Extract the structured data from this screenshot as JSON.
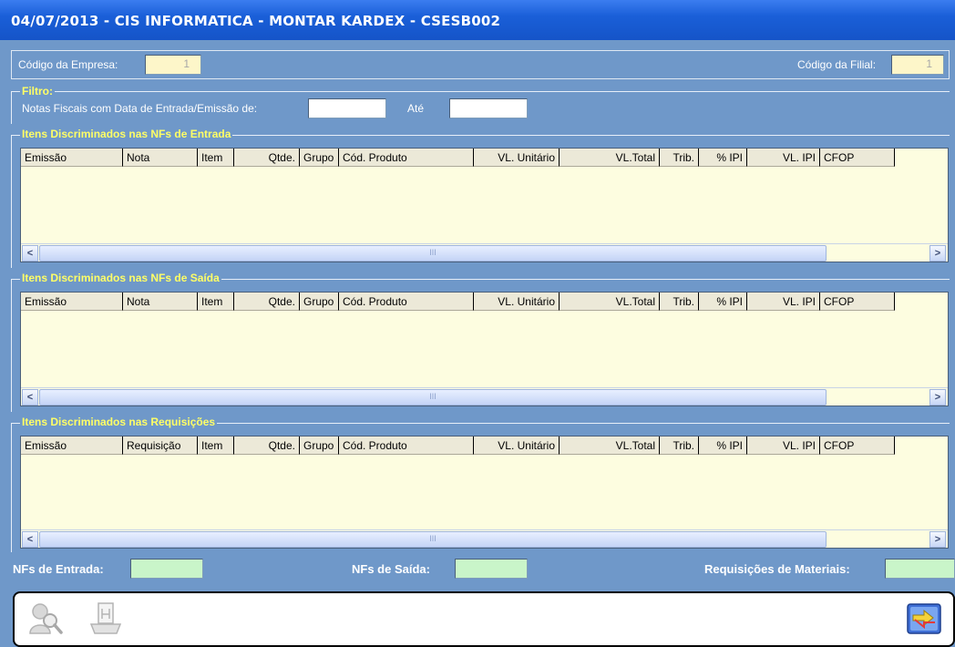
{
  "window": {
    "title": "04/07/2013  -  CIS INFORMATICA  -  MONTAR KARDEX  -  CSESB002"
  },
  "header": {
    "empresa_label": "Código da Empresa:",
    "empresa_value": "1",
    "filial_label": "Código da Filial:",
    "filial_value": "1"
  },
  "filtro": {
    "legend": "Filtro:",
    "date_label": "Notas Fiscais com Data de Entrada/Emissão de:",
    "date_from": "",
    "ate_label": "Até",
    "date_to": ""
  },
  "grids": [
    {
      "legend": "Itens Discriminados nas NFs de Entrada",
      "columns": [
        "Emissão",
        "Nota",
        "Item",
        "Qtde.",
        "Grupo",
        "Cód. Produto",
        "VL. Unitário",
        "VL.Total",
        "Trib.",
        "% IPI",
        "VL. IPI",
        "CFOP"
      ]
    },
    {
      "legend": "Itens Discriminados nas NFs de Saída",
      "columns": [
        "Emissão",
        "Nota",
        "Item",
        "Qtde.",
        "Grupo",
        "Cód. Produto",
        "VL. Unitário",
        "VL.Total",
        "Trib.",
        "% IPI",
        "VL. IPI",
        "CFOP"
      ]
    },
    {
      "legend": "Itens Discriminados nas Requisições",
      "columns": [
        "Emissão",
        "Requisição",
        "Item",
        "Qtde.",
        "Grupo",
        "Cód. Produto",
        "VL. Unitário",
        "VL.Total",
        "Trib.",
        "% IPI",
        "VL. IPI",
        "CFOP"
      ]
    }
  ],
  "scroll": {
    "left": "<",
    "right": ">",
    "thumb": "III"
  },
  "totals": {
    "entrada_label": "NFs de Entrada:",
    "entrada_value": "",
    "saida_label": "NFs de Saída:",
    "saida_value": "",
    "requisicoes_label": "Requisições de Materiais:",
    "requisicoes_value": ""
  },
  "icons": {
    "search": "search-person-icon",
    "print": "print-icon",
    "exit": "exit-arrows-icon"
  },
  "colors": {
    "background": "#6f98c9",
    "title_bar": "#1a5fd8",
    "legend": "#ffff66",
    "grid_bg": "#fdfde0",
    "total_field": "#c9f5c9"
  }
}
